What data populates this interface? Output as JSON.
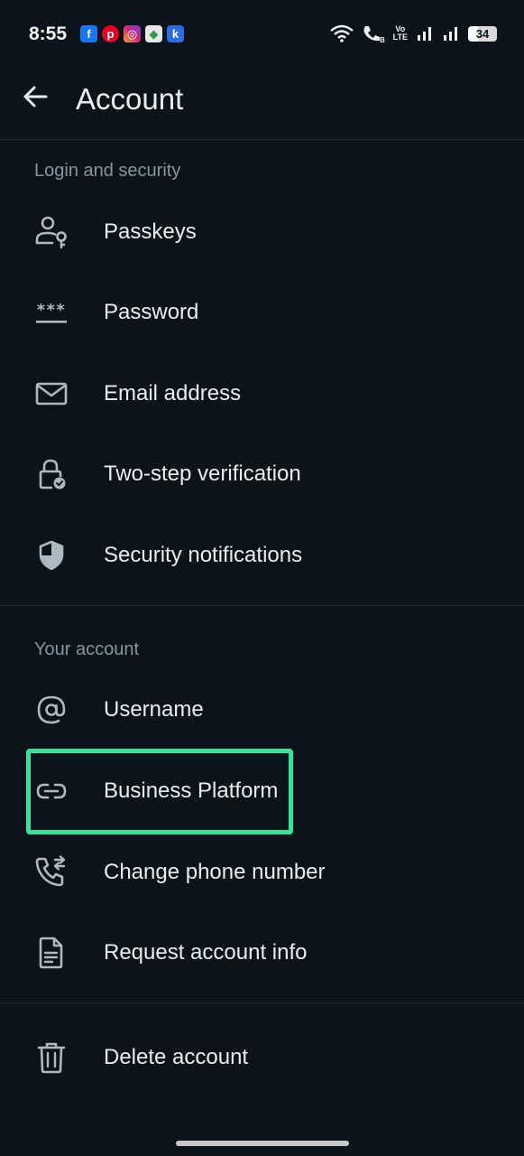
{
  "status_bar": {
    "time": "8:55",
    "notifications": [
      {
        "icon": "facebook-icon",
        "glyph": "f",
        "color": "#1877f2"
      },
      {
        "icon": "pinterest-icon",
        "glyph": "p",
        "color": "#e60023"
      },
      {
        "icon": "instagram-icon",
        "glyph": "◎",
        "color": "#d62976"
      },
      {
        "icon": "shield-app-icon",
        "glyph": "◆",
        "color": "#2e9b4f"
      },
      {
        "icon": "app-k-icon",
        "glyph": "k",
        "color": "#2b6be4"
      }
    ],
    "network_label_top": "Vo",
    "network_label_bottom": "LTE",
    "call_sim": "B",
    "battery_level": "34"
  },
  "header": {
    "title": "Account"
  },
  "sections": {
    "login_security": {
      "label": "Login and security",
      "items": [
        {
          "label": "Passkeys",
          "icon": "passkey-icon"
        },
        {
          "label": "Password",
          "icon": "password-icon"
        },
        {
          "label": "Email address",
          "icon": "email-icon"
        },
        {
          "label": "Two-step verification",
          "icon": "lock-check-icon"
        },
        {
          "label": "Security notifications",
          "icon": "shield-icon"
        }
      ]
    },
    "your_account": {
      "label": "Your account",
      "items": [
        {
          "label": "Username",
          "icon": "at-sign-icon"
        },
        {
          "label": "Business Platform",
          "icon": "link-icon"
        },
        {
          "label": "Change phone number",
          "icon": "phone-change-icon"
        },
        {
          "label": "Request account info",
          "icon": "document-icon"
        }
      ]
    },
    "danger": {
      "items": [
        {
          "label": "Delete account",
          "icon": "trash-icon"
        }
      ]
    }
  },
  "colors": {
    "background": "#0b141a",
    "text_primary": "#e9edef",
    "text_secondary": "#8696a0",
    "highlight": "#37e39a"
  }
}
